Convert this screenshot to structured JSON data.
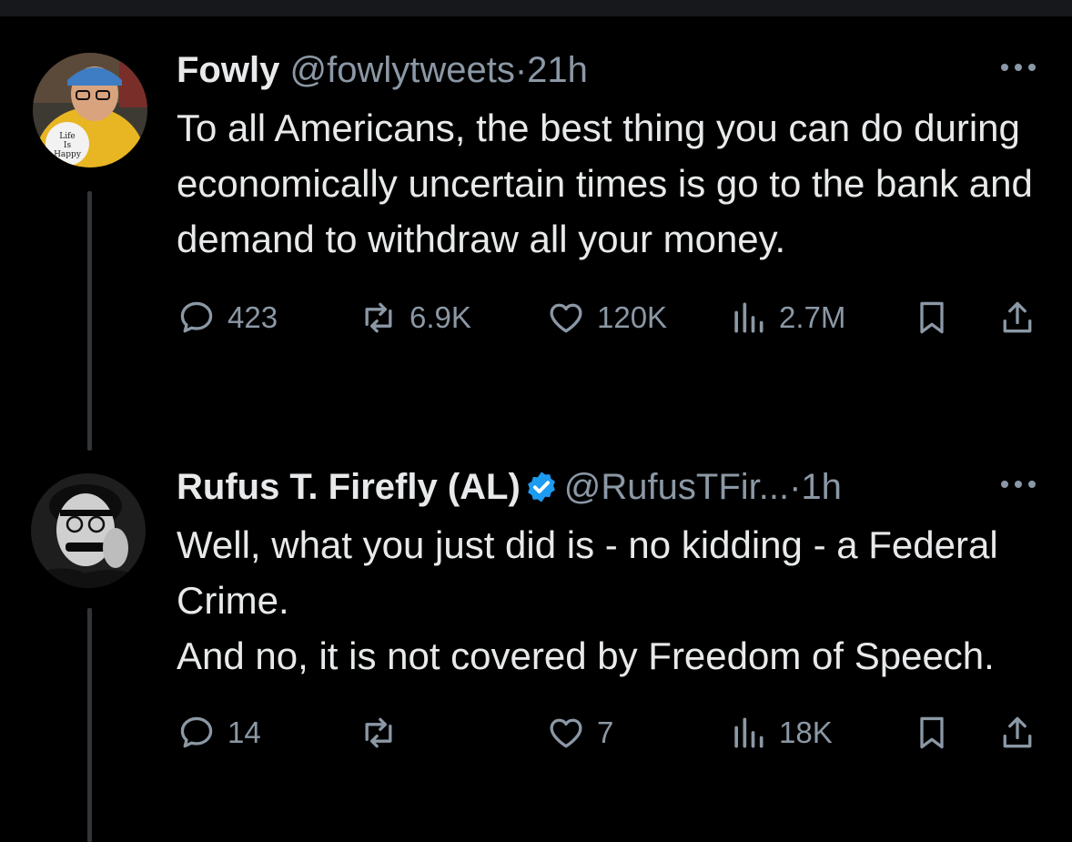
{
  "tweets": [
    {
      "name": "Fowly",
      "handle": "@fowlytweets",
      "separator": "·",
      "time": "21h",
      "verified": false,
      "avatar_text": [
        "Life",
        "Is",
        "Happy"
      ],
      "text": [
        "To all Americans, the best thing you can do during economically uncertain times is go to the bank and demand to withdraw all your money."
      ],
      "stats": {
        "replies": "423",
        "reposts": "6.9K",
        "likes": "120K",
        "views": "2.7M"
      }
    },
    {
      "name": "Rufus T. Firefly (AL)",
      "handle": "@RufusTFir...",
      "separator": "·",
      "time": "1h",
      "verified": true,
      "text": [
        "Well, what you just did is - no kidding - a Federal Crime.",
        "And no, it is not covered by Freedom of Speech."
      ],
      "stats": {
        "replies": "14",
        "reposts": "",
        "likes": "7",
        "views": "18K"
      }
    }
  ],
  "colors": {
    "background": "#000000",
    "text": "#e7e9ea",
    "muted": "#8b98a5",
    "verified": "#1d9bf0",
    "thread_line": "#333639"
  },
  "icons": [
    "reply-icon",
    "repost-icon",
    "like-icon",
    "views-icon",
    "bookmark-icon",
    "share-icon",
    "more-icon",
    "verified-badge-icon"
  ]
}
